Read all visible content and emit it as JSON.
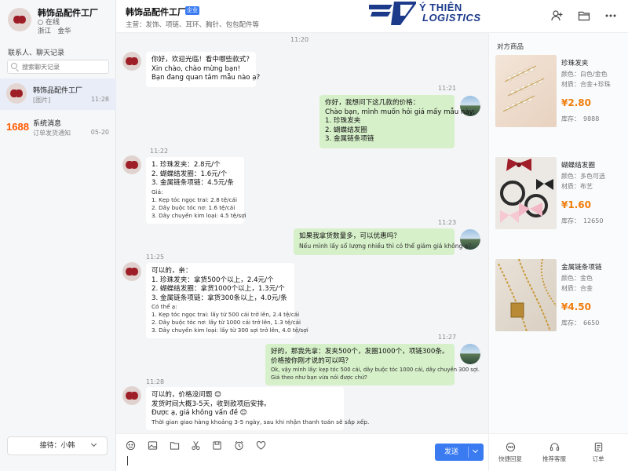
{
  "shop": {
    "name": "韩饰品配件工厂",
    "status": "在线",
    "location": "浙江　金华"
  },
  "sidebar": {
    "contacts_label": "联系人、聊天记录",
    "search_placeholder": "搜索聊天记录",
    "conversations": [
      {
        "name": "韩饰品配件工厂",
        "preview": "[图片]",
        "time": "11:28"
      },
      {
        "logo": "1688",
        "name": "系统消息",
        "preview": "订单发货通知",
        "time": "05-20"
      }
    ],
    "reception_label": "接待：小韩"
  },
  "header": {
    "name": "韩饰品配件工厂",
    "badge": "企业",
    "products": "主营：发饰、项链、耳环、胸针、包包配件等",
    "brand_line1": "Ý THIÊN",
    "brand_line2": "LOGISTICS"
  },
  "chat": {
    "messages": [
      {
        "time": "11:20",
        "dir": "in",
        "lines": [
          "你好，欢迎光临！看中哪些款式？",
          "Xin chào, chào mừng bạn!",
          "Bạn đang quan tâm mẫu nào ạ?"
        ],
        "small": []
      },
      {
        "time": "11:21",
        "dir": "out",
        "lines": [
          "你好，我想问下这几款的价格：",
          "Chào bạn, mình muốn hỏi giá mấy mẫu này:",
          "1. 珍珠发夹",
          "2. 蝴蝶结发圈",
          "3. 金属链条项链"
        ],
        "small": []
      },
      {
        "time": "11:22",
        "dir": "in",
        "lines": [
          "1. 珍珠发夹：2.8元/个",
          "2. 蝴蝶结发圈：1.6元/个",
          "3. 金属链条项链：4.5元/条"
        ],
        "small": [
          "Giá:",
          "1. Kẹp tóc ngọc trai: 2.8 tệ/cái",
          "2. Dây buộc tóc nơ: 1.6 tệ/cái",
          "3. Dây chuyền kim loại: 4.5 tệ/sợi"
        ]
      },
      {
        "time": "11:23",
        "dir": "out",
        "lines": [
          "如果我拿货数量多，可以优惠吗？"
        ],
        "small2": [
          "Nếu mình lấy số lượng nhiều thì có thể giảm giá không ạ?"
        ]
      },
      {
        "time": "11:25",
        "dir": "in",
        "lines": [
          "可以的，亲：",
          "1. 珍珠发夹：拿货500个以上，2.4元/个",
          "2. 蝴蝶结发圈：拿货1000个以上，1.3元/个",
          "3. 金属链条项链：拿货300条以上，4.0元/条"
        ],
        "small": [
          "Có thể ạ:",
          "1. Kẹp tóc ngọc trai: lấy từ 500 cái trở lên, 2.4 tệ/cái",
          "2. Dây buộc tóc nơ: lấy từ 1000 cái trở lên, 1.3 tệ/cái",
          "3. Dây chuyền kim loại: lấy từ 300 sợi trở lên, 4.0 tệ/sợi"
        ]
      },
      {
        "time": "11:27",
        "dir": "out",
        "lines": [
          "好的，那我先拿：发夹500个，发圈1000个，项链300条。",
          "价格按你刚才说的可以吗？"
        ],
        "small": [
          "Ok, vậy mình lấy: kẹp tóc 500 cái, dây buộc tóc 1000 cái, dây chuyền 300 sợi.",
          "Giá theo như bạn vừa nói được chứ?"
        ]
      },
      {
        "time": "11:28",
        "dir": "in",
        "lines": [
          "可以的，价格没问题 😊",
          "发货时间大概3-5天，收到款项后安排。",
          "Được ạ, giá không vấn đề 😊"
        ],
        "small": [
          "Thời gian giao hàng khoảng 3-5 ngày, sau khi nhận thanh toán sẽ sắp xếp."
        ]
      }
    ]
  },
  "composer": {
    "send_label": "发送"
  },
  "products": {
    "title": "对方商品",
    "items": [
      {
        "name": "珍珠发夹",
        "color": "颜色：白色/金色",
        "material": "材质：合金+珍珠",
        "price": "¥2.80",
        "stock": "库存：　9888"
      },
      {
        "name": "蝴蝶结发圈",
        "color": "颜色：多色可选",
        "material": "材质：布艺",
        "price": "¥1.60",
        "stock": "库存：　12650"
      },
      {
        "name": "金属链条项链",
        "color": "颜色：金色",
        "material": "材质：合金",
        "price": "¥4.50",
        "stock": "库存：　6650"
      }
    ]
  },
  "bottom_actions": [
    "快捷回复",
    "推荐客服",
    "订单"
  ],
  "icons": [
    "search-icon",
    "add-user-icon",
    "folder-icon",
    "more-icon",
    "emoji-icon",
    "image-icon",
    "folder-icon",
    "scissors-icon",
    "save-icon",
    "clock-icon",
    "heart-icon",
    "quick-reply-icon",
    "service-icon",
    "order-icon"
  ],
  "colors": {
    "accent": "#3a7bf2",
    "price": "#f07d0c",
    "out_bubble": "#d6f0c9",
    "brand": "#1b3a8a"
  }
}
